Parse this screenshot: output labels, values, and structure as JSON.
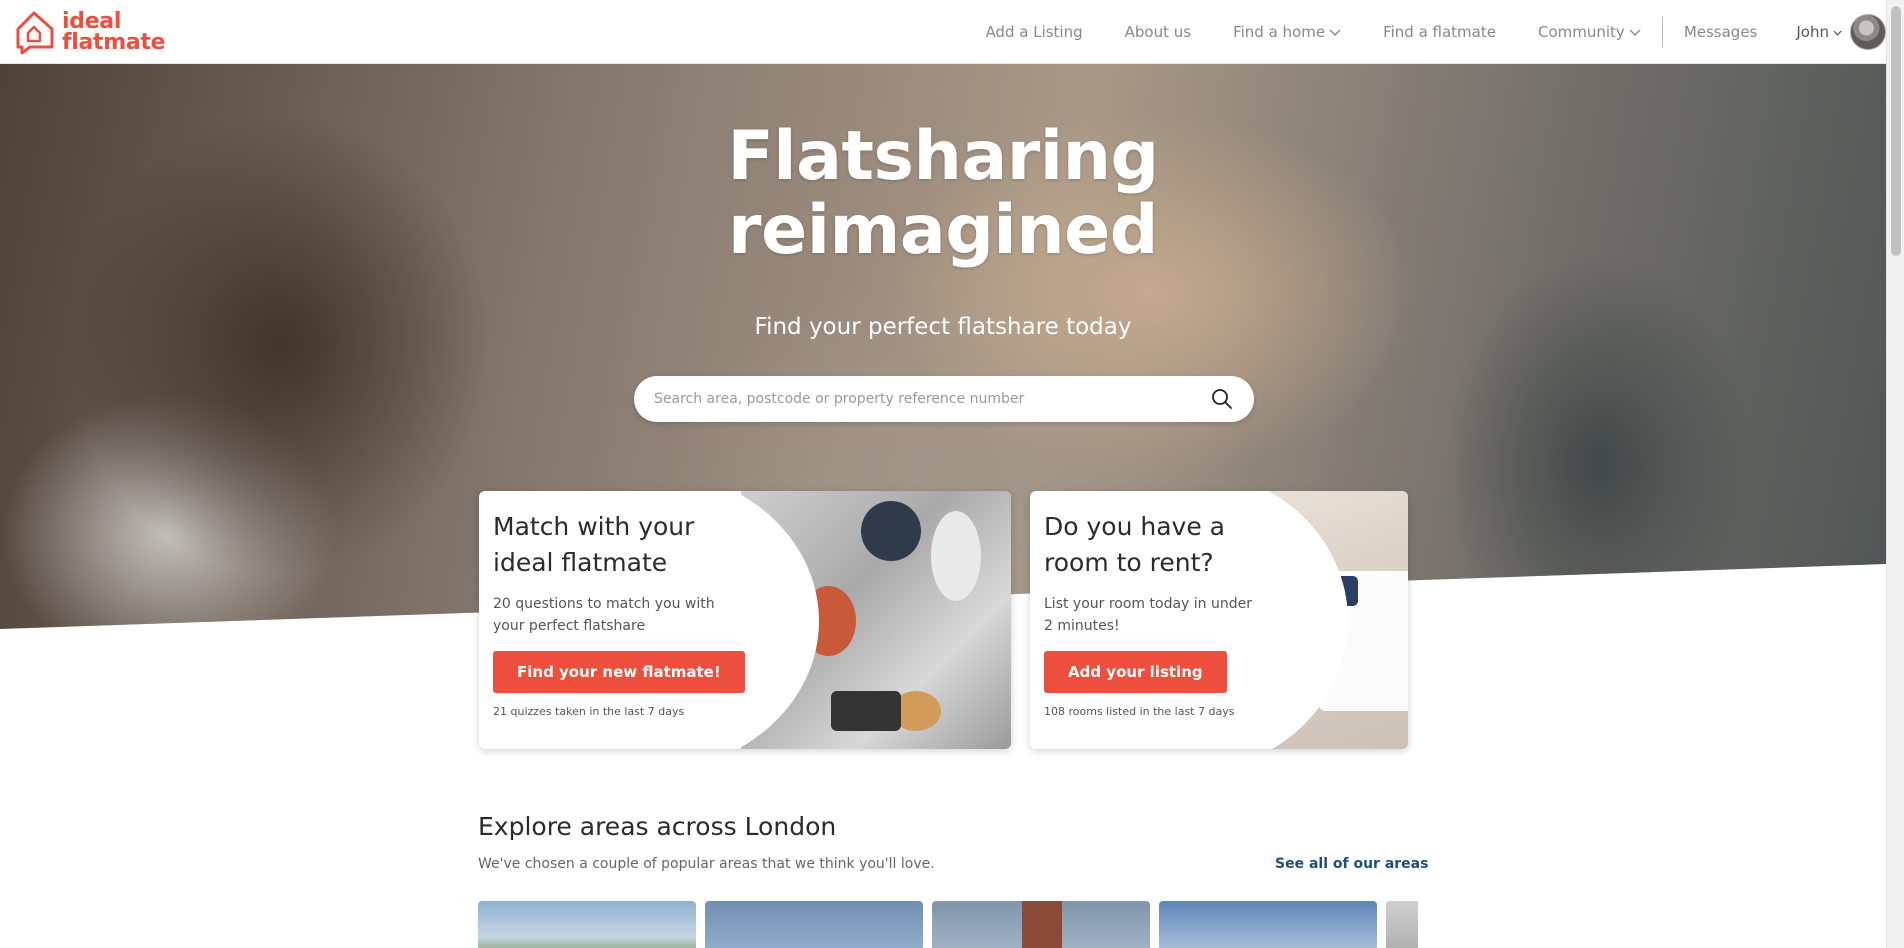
{
  "brand": {
    "line1": "ideal",
    "line2": "flatmate",
    "color": "#ee4e3d"
  },
  "nav": {
    "items": [
      {
        "label": "Add a Listing",
        "dropdown": false
      },
      {
        "label": "About us",
        "dropdown": false
      },
      {
        "label": "Find a home",
        "dropdown": true
      },
      {
        "label": "Find a flatmate",
        "dropdown": false
      },
      {
        "label": "Community",
        "dropdown": true
      }
    ],
    "messages": "Messages",
    "user": "John"
  },
  "hero": {
    "title_line1": "Flatsharing",
    "title_line2": "reimagined",
    "subtitle": "Find your perfect flatshare today",
    "search_placeholder": "Search area, postcode or property reference number"
  },
  "cards": [
    {
      "title_line1": "Match with your",
      "title_line2": "ideal flatmate",
      "desc_line1": "20 questions to match you with",
      "desc_line2": "your perfect flatshare",
      "button": "Find your new flatmate!",
      "note": "21 quizzes taken in the last 7 days"
    },
    {
      "title_line1": "Do you have a",
      "title_line2": "room to rent?",
      "desc_line1": "List your room today in under",
      "desc_line2": "2 minutes!",
      "button": "Add your listing",
      "note": "108 rooms listed in the last 7 days"
    }
  ],
  "explore": {
    "title": "Explore areas across London",
    "subtitle": "We've chosen a couple of popular areas that we think you'll love.",
    "link": "See all of our areas"
  }
}
